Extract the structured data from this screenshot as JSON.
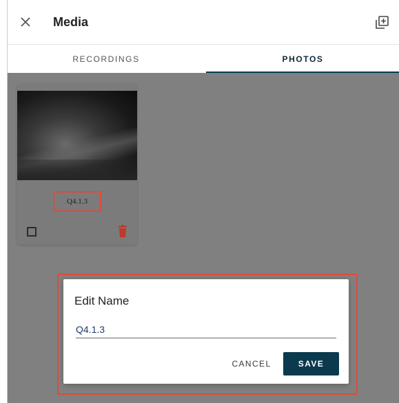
{
  "header": {
    "title": "Media",
    "close_icon": "close-icon",
    "add_icon": "library-add-icon"
  },
  "tabs": [
    {
      "label": "RECORDINGS",
      "active": false
    },
    {
      "label": "PHOTOS",
      "active": true
    }
  ],
  "photos": [
    {
      "name": "Q4.1.3",
      "selected": false
    }
  ],
  "dialog": {
    "title": "Edit Name",
    "input_value": "Q4.1.3",
    "cancel_label": "CANCEL",
    "save_label": "SAVE"
  },
  "colors": {
    "accent": "#0b3a4f",
    "highlight_outline": "#e04a3a",
    "delete": "#c0392b",
    "overlay": "#808080"
  }
}
